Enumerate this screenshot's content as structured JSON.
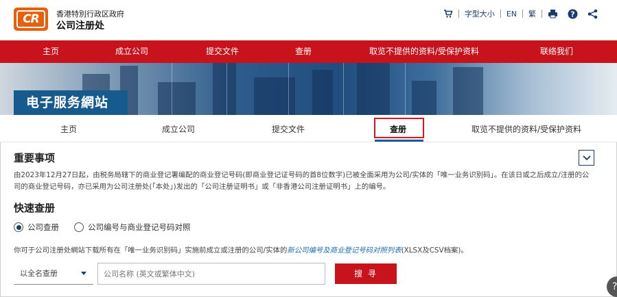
{
  "header": {
    "logo_text": "CR",
    "org_line1": "香港特別行政区政府",
    "org_line2": "公司注册处",
    "tools": {
      "text_size": "字型大小",
      "english": "EN",
      "traditional": "繁"
    },
    "icons": [
      "cart-icon",
      "print-icon",
      "help-icon",
      "share-icon"
    ]
  },
  "main_nav": {
    "items": [
      "主页",
      "成立公司",
      "提交文件",
      "查册",
      "取览不提供的资料/受保护资料",
      "联络我们"
    ]
  },
  "banner": {
    "title": "电子服务網站"
  },
  "sub_nav": {
    "items": [
      "主页",
      "成立公司",
      "提交文件",
      "查册",
      "取览不提供的资料/受保护资料"
    ],
    "active": "查册"
  },
  "important": {
    "heading": "重要事项",
    "notice": "由2023年12月27日起，由税务局辖下的商业登记署编配的商业登记号码(即商业登记证号码的首8位数字)已被全面采用为公司/实体的「唯一业务识别码」。在该日或之后成立/注册的公司的商业登记号码，亦已采用为公司注册处(「本处」)发出的「公司注册证明书」或「非香港公司注册证明书」上的编号。"
  },
  "quick_search": {
    "heading": "快速查册",
    "radio_company": "公司查册",
    "radio_mapping": "公司编号与商业登记号码对照",
    "desc_prefix": "你可于公司注册处網站下载所有在「唯一业务识别码」实施前成立或注册的公司/实体的",
    "desc_link": "新公司编号及商业登记号码对照列表",
    "desc_suffix": "(XLSX及CSV档案)。",
    "select_value": "以全名查册",
    "input_placeholder": "公司名称 (英文或繁体中文)",
    "search_button": "搜 寻"
  },
  "floating": {
    "help_label": "?"
  },
  "colors": {
    "brand_red": "#c8131d",
    "logo_orange": "#e8600c",
    "banner_blue": "#175a8e",
    "link_blue": "#1a6fb0",
    "active_box_red": "#e0131f"
  }
}
